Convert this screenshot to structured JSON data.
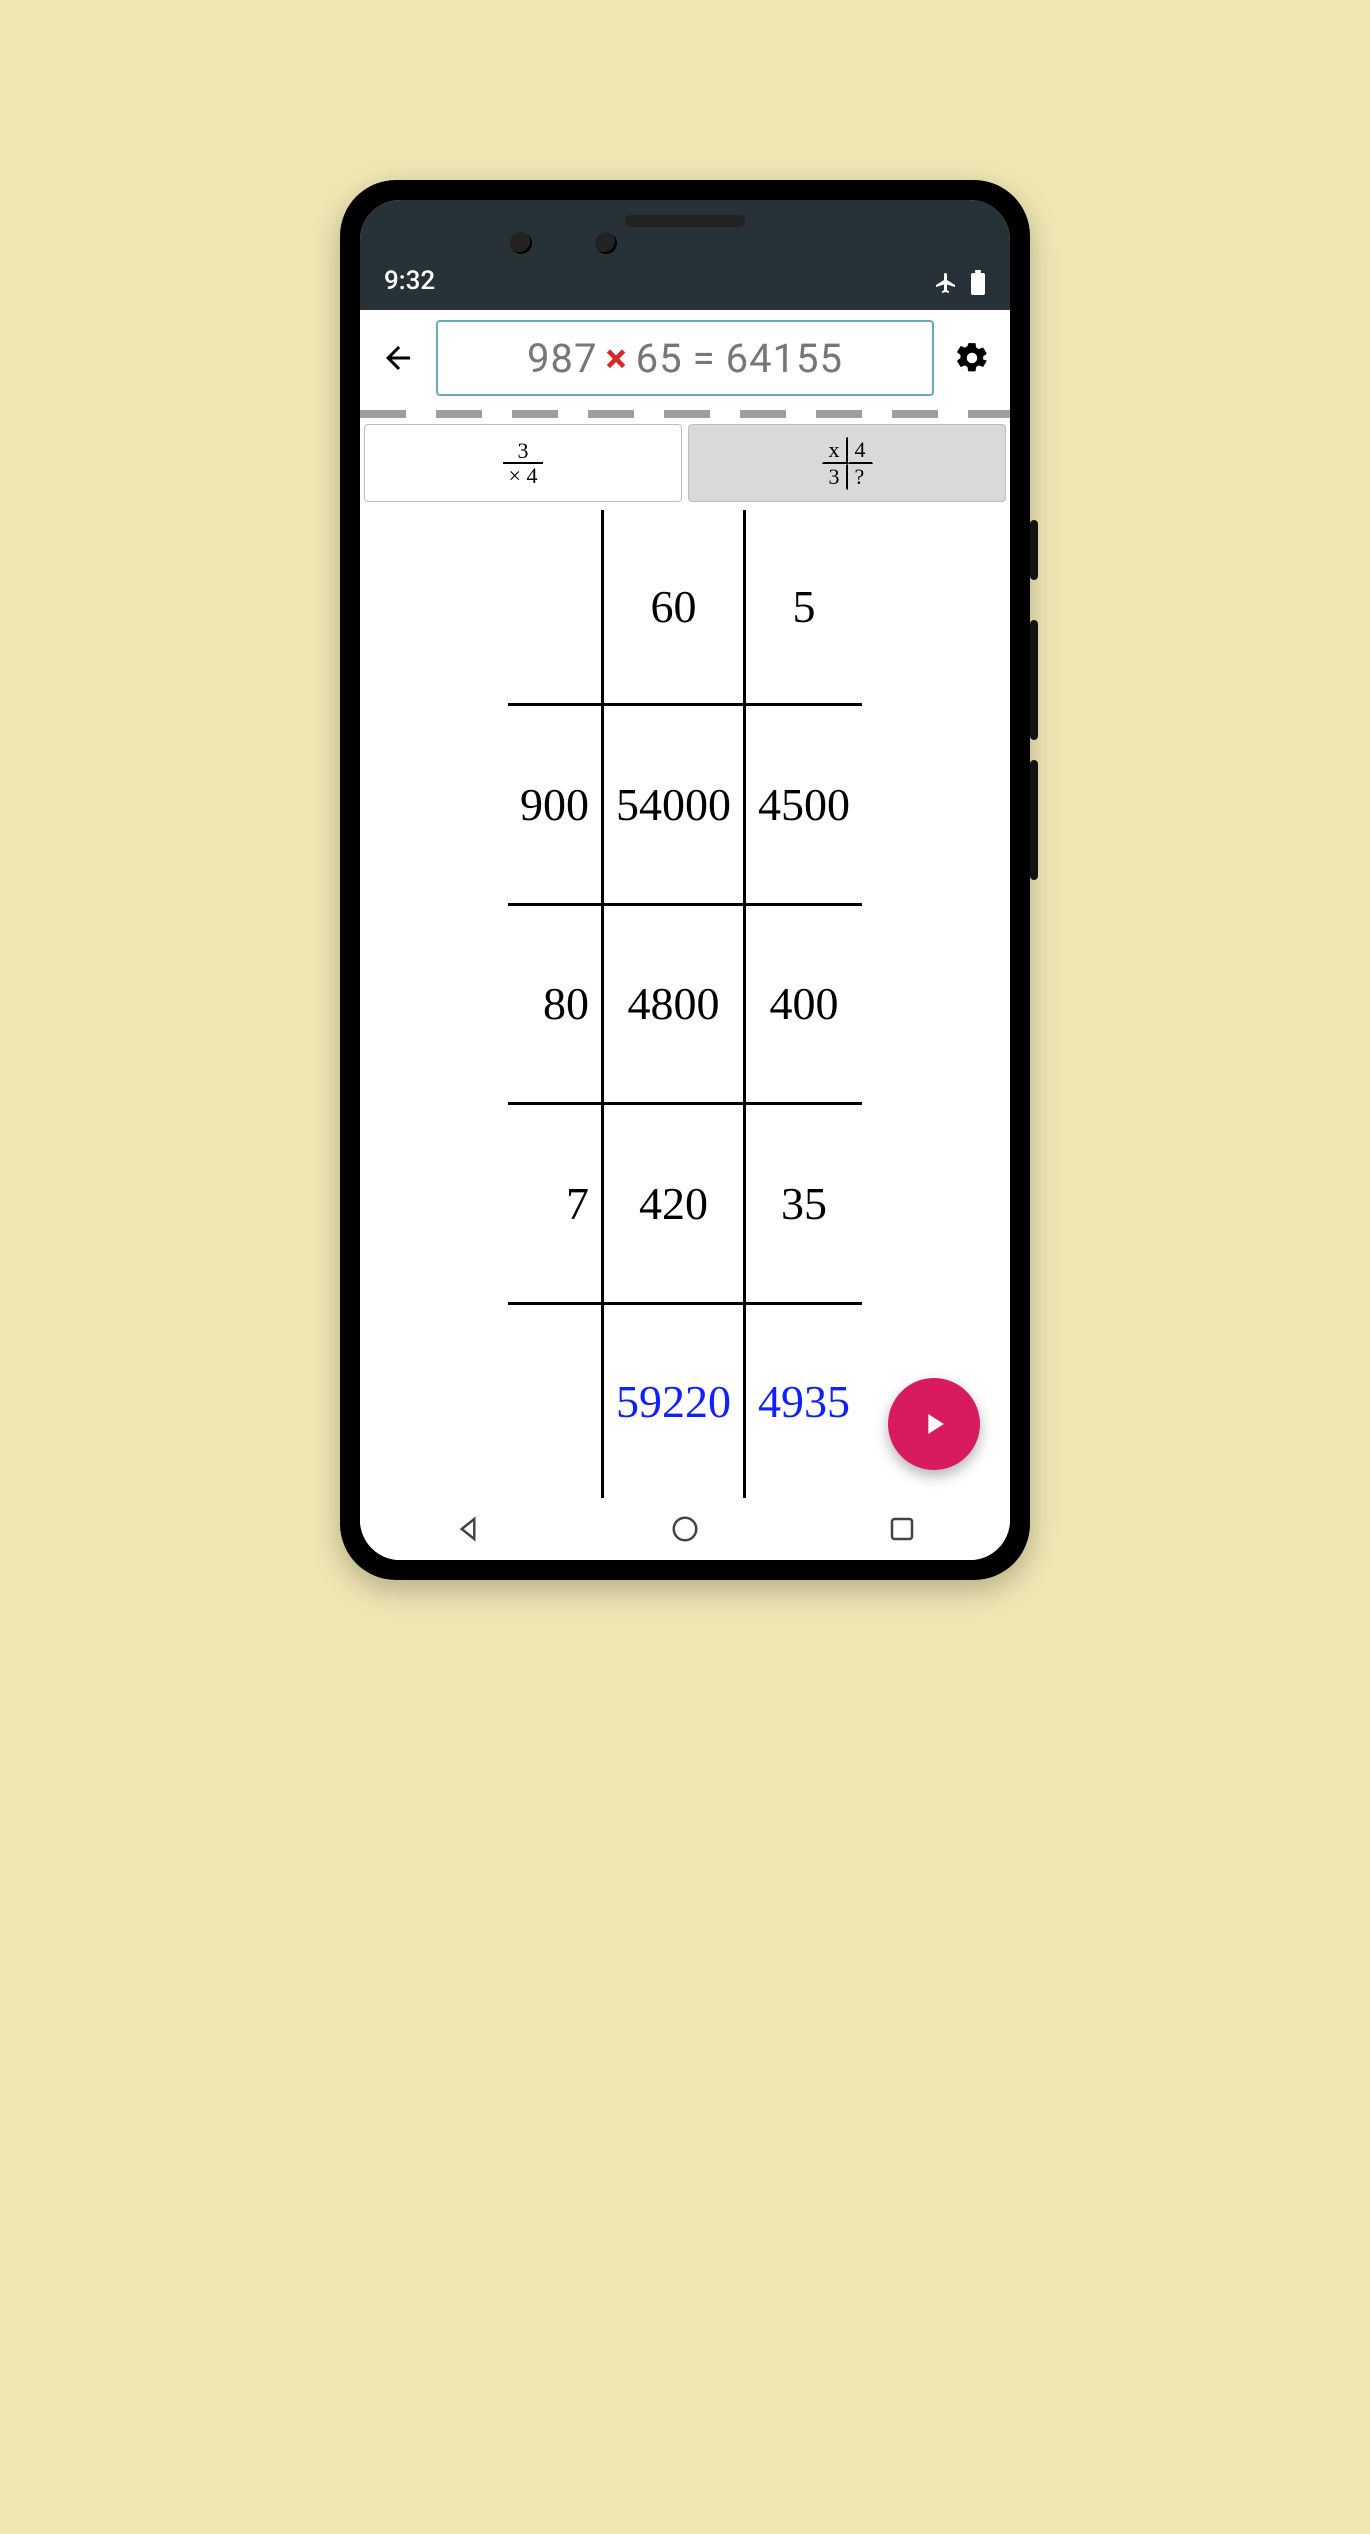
{
  "status": {
    "time": "9:32"
  },
  "expression": {
    "lhs_a": "987",
    "op": "×",
    "lhs_b": "65",
    "eq": "=",
    "result": "64155"
  },
  "tabs": {
    "standard_icon": {
      "top_label": "3",
      "bottom_label": "× 4"
    },
    "grid_icon": {
      "tl": "x",
      "tr": "4",
      "bl": "3",
      "br": "?"
    }
  },
  "grid": {
    "col_headers": [
      "60",
      "5"
    ],
    "rows": [
      {
        "label": "900",
        "cells": [
          "54000",
          "4500"
        ]
      },
      {
        "label": "80",
        "cells": [
          "4800",
          "400"
        ]
      },
      {
        "label": "7",
        "cells": [
          "420",
          "35"
        ]
      }
    ],
    "col_sums": [
      "59220",
      "4935"
    ]
  },
  "colors": {
    "accent": "#d81b60",
    "operator": "#d62828",
    "sum": "#1020ff",
    "input_border": "#69a9b9"
  }
}
